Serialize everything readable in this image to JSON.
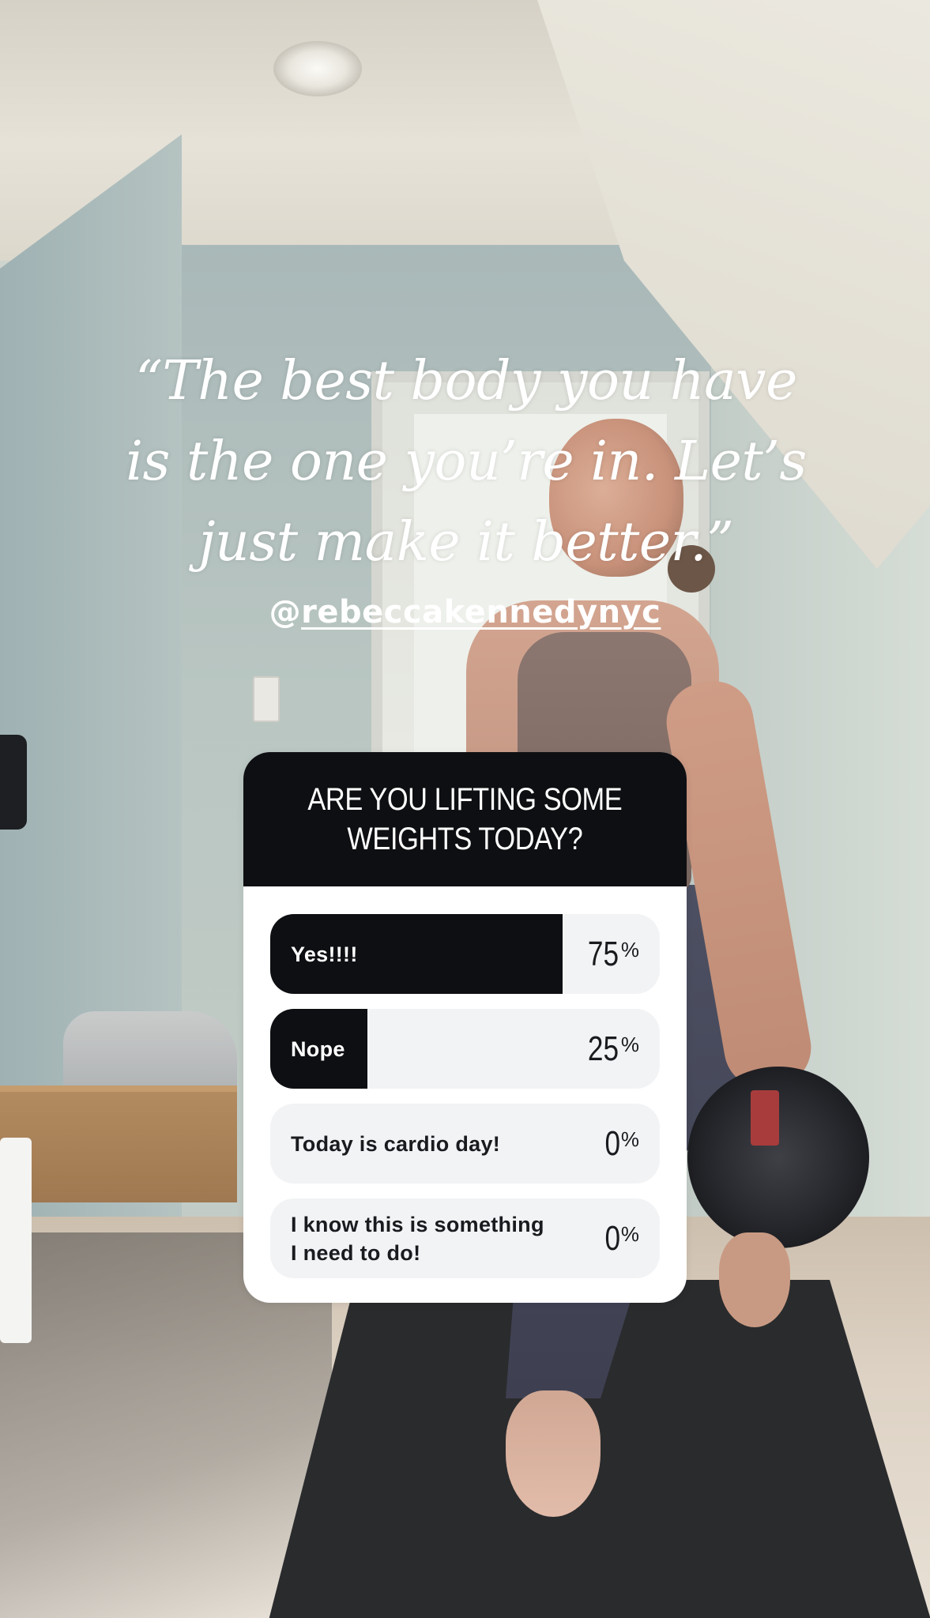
{
  "story": {
    "quote": "“The best body you have is the one you’re in. Let’s just make it better.”",
    "mention_at": "@",
    "mention_handle": "rebeccakennedynyc"
  },
  "poll": {
    "question": "ARE YOU LIFTING SOME\nWEIGHTS TODAY?",
    "options": [
      {
        "label": "Yes!!!!",
        "percent": 75,
        "percent_text": "75",
        "selected": true
      },
      {
        "label": "Nope",
        "percent": 25,
        "percent_text": "25",
        "selected": true
      },
      {
        "label": "Today is cardio day!",
        "percent": 0,
        "percent_text": "0",
        "selected": false
      },
      {
        "label": "I know this is something\nI need to do!",
        "percent": 0,
        "percent_text": "0",
        "selected": false
      }
    ],
    "percent_sign": "%"
  },
  "colors": {
    "poll_dark": "#0e0f12",
    "poll_option_bg": "#f2f3f5",
    "text_white": "#ffffff"
  }
}
